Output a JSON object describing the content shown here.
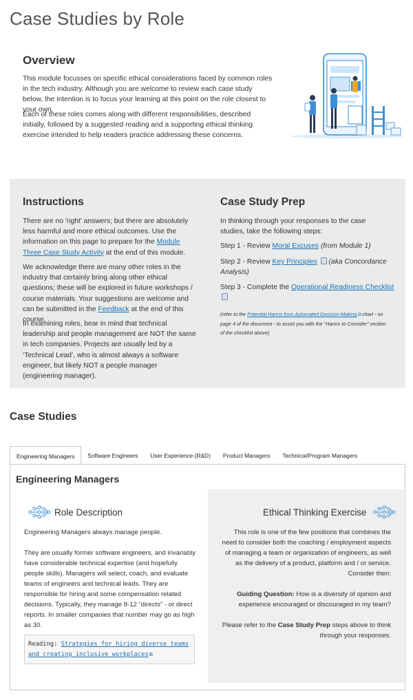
{
  "page": {
    "title": "Case Studies by Role"
  },
  "overview": {
    "title": "Overview",
    "para1": "This module focusses on specific ethical considerations faced by common roles in the tech industry. Although you are welcome to review each case study below, the intention is to focus your learning at this point on the role closest to your own.",
    "para2": "Each of these roles comes along with different responsibilities, described initially, followed by a suggested reading and a supporting ethical thinking exercise intended to help readers practice addressing these concerns."
  },
  "instructions": {
    "title": "Instructions",
    "p1_a": "There are no 'right' answers; but there are absolutely less harmful and more ethical outcomes. Use the information on this page to prepare for the ",
    "p1_link": "Module Three Case Study Activity",
    "p1_b": " at the end of this module.",
    "p2_a": "We acknowledge there are many other roles in the industry that certainly bring along other ethical questions; these will be explored in future workshops / course materials.  Your suggestions are welcome and can be submitted in the ",
    "p2_link": "Feedback",
    "p2_b": " at the end of this course.",
    "p3": "In examining roles, bear in mind that technical leadership and people management are NOT the same in tech companies.  Projects are usually led by a ‘Technical Lead’, who is almost always a software engineer, but likely NOT a people manager (engineering manager)."
  },
  "prep": {
    "title": "Case Study Prep",
    "intro": "In thinking through your responses to the case studies, take the following steps:",
    "step1_a": "Step 1 - Review ",
    "step1_link": "Moral Excuses",
    "step1_b": "(from Module 1)",
    "step2_a": "Step 2 - Review ",
    "step2_link": "Key Principles",
    "step2_b": "(aka Concordance Analysis)",
    "step3_a": "Step 3 - Complete the ",
    "step3_link": "Operational Readiness Checklist",
    "note_a": "(refer to the ",
    "note_link": "Potential Harms from Automated Decision-Making",
    "note_b": " chart - on page 4 of the document - to assist you with the \"Harms to Consider\" section of the checklist above)"
  },
  "case_studies": {
    "title": "Case Studies",
    "tabs": [
      "Engineering Managers",
      "Software Engineers",
      "User Experience (R&D)",
      "Product Managers",
      "Technical/Program Managers"
    ],
    "active_tab": 0,
    "panel_title": "Engineering Managers",
    "role_title": "Role Description",
    "role_p1": "Engineering Managers always manage people.",
    "role_p2": "They are usually former software engineers, and invariably have considerable technical expertise (and hopefully people skills). Managers will select, coach, and evaluate teams of engineers and technical leads. They are responsible for hiring and some compensation related decisions. Typically, they manage 8-12 “directs” - or direct reports.  In smaller companies that number may go as high as 30.",
    "reading_label": "Reading: ",
    "reading_link": "Strategies for hiring diverse teams and creating inclusive workplaces",
    "exercise_title": "Ethical Thinking Exercise",
    "ex_p1": "This role is one of the few positions that combines the need to consider both the coaching / employment aspects of managing a team or organization of engineers, as well as the delivery of a product, platform and / or service.  Consider then:",
    "ex_q_label": "Guiding Question:",
    "ex_q": " How is a diversity of opinion and experience encouraged or discouraged in my team?",
    "ex_p3_a": "Please refer to the ",
    "ex_p3_bold": "Case Study Prep",
    "ex_p3_b": " steps above to think through your responses."
  },
  "colors": {
    "link": "#1a6fb5",
    "panel_bg": "#e9ecea",
    "exercise_bg": "#efefef",
    "illustration_blue": "#3b8fd6"
  },
  "icons": [
    "document-icon",
    "external-link-icon",
    "circuit-brain-icon",
    "phone-team-illustration"
  ]
}
